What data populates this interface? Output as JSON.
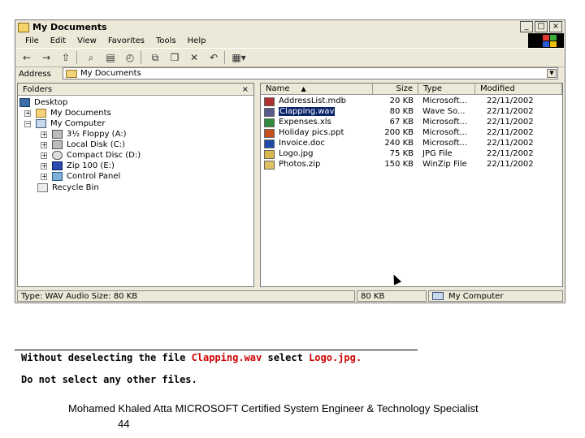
{
  "window": {
    "title": "My Documents",
    "controls": [
      "_",
      "□",
      "×"
    ]
  },
  "menu": [
    "File",
    "Edit",
    "View",
    "Favorites",
    "Tools",
    "Help"
  ],
  "toolbar": {
    "buttons": [
      "back-icon",
      "forward-icon",
      "up-folder-icon",
      "search-icon",
      "folders-icon",
      "history-icon",
      "move-to-icon",
      "copy-to-icon",
      "delete-icon",
      "undo-icon",
      "views-icon"
    ]
  },
  "address": {
    "label": "Address",
    "value": "My Documents"
  },
  "folders": {
    "header": "Folders",
    "close": "×",
    "tree": [
      {
        "label": "Desktop",
        "icon": "desktop-icon"
      },
      {
        "label": "My Documents",
        "icon": "folder-icon"
      },
      {
        "label": "My Computer",
        "icon": "computer-icon"
      },
      {
        "label": "3½ Floppy (A:)",
        "icon": "floppy-icon"
      },
      {
        "label": "Local Disk (C:)",
        "icon": "drive-icon"
      },
      {
        "label": "Compact Disc (D:)",
        "icon": "cd-icon"
      },
      {
        "label": "Zip 100  (E:)",
        "icon": "zip-drive-icon"
      },
      {
        "label": "Control Panel",
        "icon": "control-panel-icon"
      },
      {
        "label": "Recycle Bin",
        "icon": "recycle-bin-icon"
      }
    ]
  },
  "files": {
    "columns": [
      "Name",
      "Size",
      "Type",
      "Modified"
    ],
    "rows": [
      {
        "name": "AddressList.mdb",
        "size": "20 KB",
        "type": "Microsoft...",
        "modified": "22/11/2002",
        "color": "#b03030",
        "selected": false
      },
      {
        "name": "Clapping.wav",
        "size": "80 KB",
        "type": "Wave So...",
        "modified": "22/11/2002",
        "color": "#5a5a8a",
        "selected": true
      },
      {
        "name": "Expenses.xls",
        "size": "67 KB",
        "type": "Microsoft...",
        "modified": "22/11/2002",
        "color": "#2e8b3a",
        "selected": false
      },
      {
        "name": "Holiday pics.ppt",
        "size": "200 KB",
        "type": "Microsoft...",
        "modified": "22/11/2002",
        "color": "#c8501e",
        "selected": false
      },
      {
        "name": "Invoice.doc",
        "size": "240 KB",
        "type": "Microsoft...",
        "modified": "22/11/2002",
        "color": "#1f4aa8",
        "selected": false
      },
      {
        "name": "Logo.jpg",
        "size": "75 KB",
        "type": "JPG File",
        "modified": "22/11/2002",
        "color": "#d8b84a",
        "selected": false
      },
      {
        "name": "Photos.zip",
        "size": "150 KB",
        "type": "WinZip File",
        "modified": "22/11/2002",
        "color": "#e0c060",
        "selected": false
      }
    ]
  },
  "status": {
    "left": "Type: WAV Audio Size: 80 KB",
    "size": "80 KB",
    "zone": "My Computer"
  },
  "instructions": {
    "line1_a": "Without deselecting the file",
    "line1_file1": "Clapping.wav",
    "line1_b": "select",
    "line1_file2": "Logo.jpg.",
    "line2": "Do not select any other files."
  },
  "footer": {
    "credit": "Mohamed Khaled Atta MICROSOFT Certified System Engineer & Technology Specialist",
    "page": "44"
  },
  "colors": {
    "selection": "#0a246a",
    "instruction_highlight": "#cc0000",
    "window_face": "#ece9d8"
  }
}
